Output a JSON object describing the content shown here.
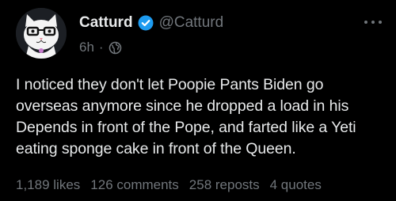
{
  "post": {
    "author": {
      "display_name": "Catturd",
      "handle": "@Catturd",
      "verified": true,
      "verified_color": "#1d9bf0"
    },
    "time": "6h",
    "separator": "·",
    "visibility_icon": "globe-icon",
    "text": "I noticed they don't let Poopie Pants Biden go overseas anymore since he dropped a load in his Depends in front of the Pope, and farted like a Yeti eating sponge cake in front of the Queen.",
    "stats": {
      "likes": "1,189 likes",
      "comments": "126 comments",
      "reposts": "258 reposts",
      "quotes": "4 quotes"
    }
  },
  "colors": {
    "background": "#000000",
    "primary_text": "#e7e9ea",
    "secondary_text": "#71767b"
  }
}
